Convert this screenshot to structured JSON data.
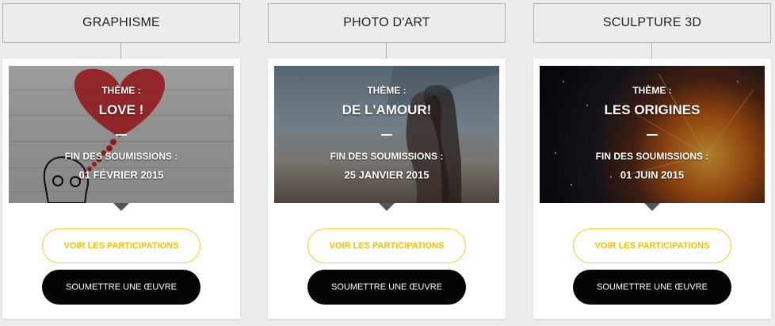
{
  "categories": [
    {
      "header": "GRAPHISME",
      "theme_label": "THÈME :",
      "theme_value": "LOVE !",
      "deadline_label": "FIN DES SOUMISSIONS :",
      "deadline_value": "01 FÉVRIER 2015",
      "view_button": "VOIR LES PARTICIPATIONS",
      "submit_button": "SOUMETTRE UNE ŒUVRE"
    },
    {
      "header": "PHOTO D'ART",
      "theme_label": "THÈME :",
      "theme_value": "DE L'AMOUR!",
      "deadline_label": "FIN DES SOUMISSIONS :",
      "deadline_value": "25 JANVIER 2015",
      "view_button": "VOIR LES PARTICIPATIONS",
      "submit_button": "SOUMETTRE UNE ŒUVRE"
    },
    {
      "header": "SCULPTURE 3D",
      "theme_label": "THÈME :",
      "theme_value": "LES ORIGINES",
      "deadline_label": "FIN DES SOUMISSIONS :",
      "deadline_value": "01 JUIN 2015",
      "view_button": "VOIR LES PARTICIPATIONS",
      "submit_button": "SOUMETTRE UNE ŒUVRE"
    }
  ],
  "colors": {
    "accent_yellow": "#f2c200",
    "button_black": "#050505",
    "page_background": "#ececec",
    "heart_red": "#c8252a"
  }
}
